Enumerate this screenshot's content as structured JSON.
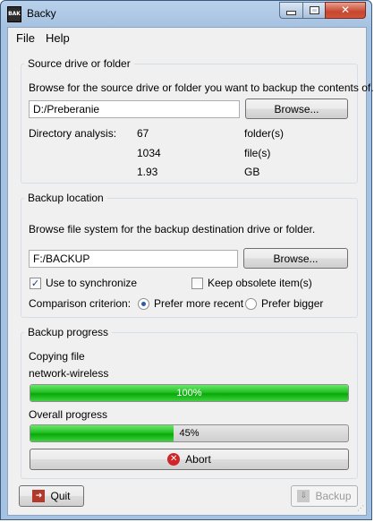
{
  "window": {
    "title": "Backy",
    "icon_label": "BAK",
    "icon": "backy-app-icon"
  },
  "menu": {
    "file": "File",
    "help": "Help"
  },
  "source": {
    "group_title": "Source drive or folder",
    "instructions": "Browse for the source drive or folder you want to backup the contents of.",
    "path_value": "D:/Preberanie",
    "browse_label": "Browse...",
    "analysis_label": "Directory analysis:",
    "folders_count": "67",
    "folders_unit": "folder(s)",
    "files_count": "1034",
    "files_unit": "file(s)",
    "size_value": "1.93",
    "size_unit": "GB"
  },
  "destination": {
    "group_title": "Backup location",
    "instructions": "Browse file system for the backup destination drive or folder.",
    "path_value": "F:/BACKUP",
    "browse_label": "Browse...",
    "sync_label": "Use to synchronize",
    "sync_checked": true,
    "keep_obsolete_label": "Keep obsolete item(s)",
    "keep_obsolete_checked": false,
    "criterion_label": "Comparison criterion:",
    "prefer_recent_label": "Prefer more recent",
    "prefer_bigger_label": "Prefer bigger",
    "selected_criterion": "prefer_recent"
  },
  "progress": {
    "group_title": "Backup progress",
    "copying_label": "Copying file",
    "current_file": "network-wireless",
    "file_progress_percent": 100,
    "file_progress_text": "100%",
    "overall_label": "Overall progress",
    "overall_percent": 45,
    "overall_text": "45%",
    "abort_label": "Abort"
  },
  "footer": {
    "quit_label": "Quit",
    "backup_label": "Backup",
    "backup_enabled": false
  },
  "colors": {
    "progress_green": "#23c023",
    "abort_red": "#d0262a",
    "titlebar_blue": "#b9d1ea"
  }
}
